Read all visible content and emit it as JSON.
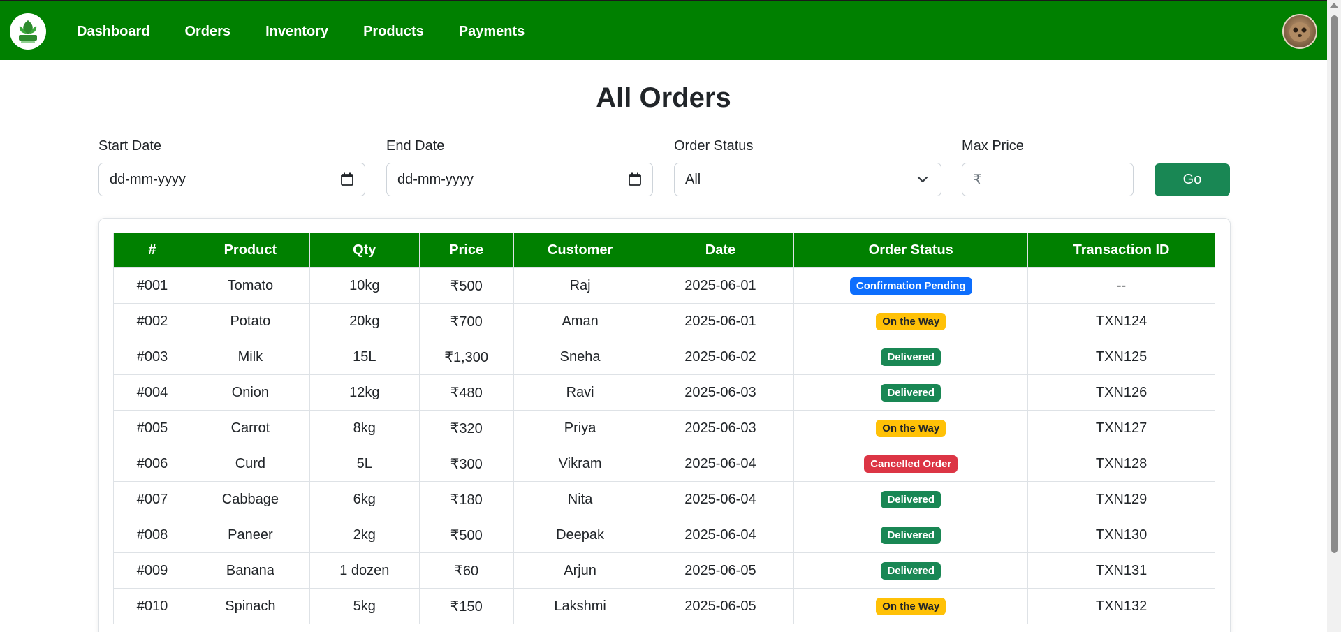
{
  "nav": {
    "items": [
      {
        "label": "Dashboard"
      },
      {
        "label": "Orders"
      },
      {
        "label": "Inventory"
      },
      {
        "label": "Products"
      },
      {
        "label": "Payments"
      }
    ],
    "logo_icon": "leaf-logo-icon",
    "avatar_icon": "user-avatar"
  },
  "page": {
    "title": "All Orders"
  },
  "filters": {
    "start_date": {
      "label": "Start Date",
      "placeholder": "dd-mm-yyyy"
    },
    "end_date": {
      "label": "End Date",
      "placeholder": "dd-mm-yyyy"
    },
    "status": {
      "label": "Order Status",
      "value": "All"
    },
    "max_price": {
      "label": "Max Price",
      "prefix": "₹",
      "value": ""
    },
    "go_label": "Go"
  },
  "table": {
    "headers": [
      "#",
      "Product",
      "Qty",
      "Price",
      "Customer",
      "Date",
      "Order Status",
      "Transaction ID"
    ],
    "rows": [
      {
        "id": "#001",
        "product": "Tomato",
        "qty": "10kg",
        "price": "₹500",
        "customer": "Raj",
        "date": "2025-06-01",
        "status": "Confirmation Pending",
        "status_type": "pending",
        "txn": "--"
      },
      {
        "id": "#002",
        "product": "Potato",
        "qty": "20kg",
        "price": "₹700",
        "customer": "Aman",
        "date": "2025-06-01",
        "status": "On the Way",
        "status_type": "way",
        "txn": "TXN124"
      },
      {
        "id": "#003",
        "product": "Milk",
        "qty": "15L",
        "price": "₹1,300",
        "customer": "Sneha",
        "date": "2025-06-02",
        "status": "Delivered",
        "status_type": "delivered",
        "txn": "TXN125"
      },
      {
        "id": "#004",
        "product": "Onion",
        "qty": "12kg",
        "price": "₹480",
        "customer": "Ravi",
        "date": "2025-06-03",
        "status": "Delivered",
        "status_type": "delivered",
        "txn": "TXN126"
      },
      {
        "id": "#005",
        "product": "Carrot",
        "qty": "8kg",
        "price": "₹320",
        "customer": "Priya",
        "date": "2025-06-03",
        "status": "On the Way",
        "status_type": "way",
        "txn": "TXN127"
      },
      {
        "id": "#006",
        "product": "Curd",
        "qty": "5L",
        "price": "₹300",
        "customer": "Vikram",
        "date": "2025-06-04",
        "status": "Cancelled Order",
        "status_type": "cancelled",
        "txn": "TXN128"
      },
      {
        "id": "#007",
        "product": "Cabbage",
        "qty": "6kg",
        "price": "₹180",
        "customer": "Nita",
        "date": "2025-06-04",
        "status": "Delivered",
        "status_type": "delivered",
        "txn": "TXN129"
      },
      {
        "id": "#008",
        "product": "Paneer",
        "qty": "2kg",
        "price": "₹500",
        "customer": "Deepak",
        "date": "2025-06-04",
        "status": "Delivered",
        "status_type": "delivered",
        "txn": "TXN130"
      },
      {
        "id": "#009",
        "product": "Banana",
        "qty": "1 dozen",
        "price": "₹60",
        "customer": "Arjun",
        "date": "2025-06-05",
        "status": "Delivered",
        "status_type": "delivered",
        "txn": "TXN131"
      },
      {
        "id": "#010",
        "product": "Spinach",
        "qty": "5kg",
        "price": "₹150",
        "customer": "Lakshmi",
        "date": "2025-06-05",
        "status": "On the Way",
        "status_type": "way",
        "txn": "TXN132"
      }
    ]
  },
  "colors": {
    "brand": "#008000",
    "go_button": "#198754",
    "status": {
      "pending": {
        "bg": "#0d6efd",
        "fg": "#ffffff"
      },
      "way": {
        "bg": "#ffc107",
        "fg": "#212529"
      },
      "delivered": {
        "bg": "#198754",
        "fg": "#ffffff"
      },
      "cancelled": {
        "bg": "#dc3545",
        "fg": "#ffffff"
      }
    }
  }
}
